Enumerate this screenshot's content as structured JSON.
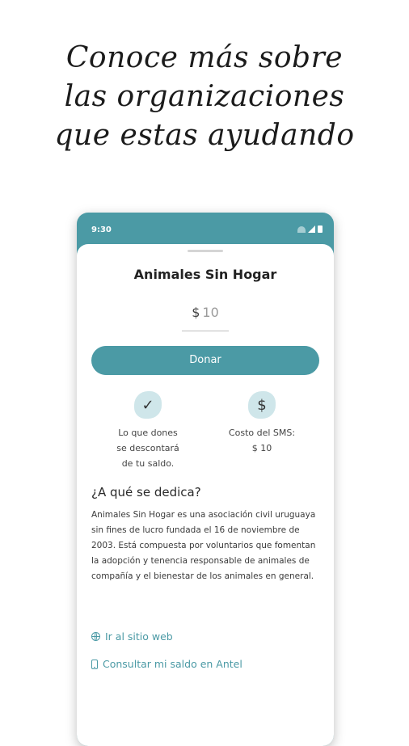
{
  "headline": [
    "Conoce más sobre",
    "las organizaciones",
    "que estas ayudando"
  ],
  "status": {
    "time": "9:30"
  },
  "organization": {
    "name": "Animales Sin Hogar"
  },
  "donation": {
    "currency": "$",
    "amount": "10",
    "button_label": "Donar"
  },
  "info": [
    {
      "icon": "check-icon",
      "glyph": "✓",
      "lines": [
        "Lo que dones",
        "se descontará",
        "de tu saldo."
      ]
    },
    {
      "icon": "dollar-icon",
      "glyph": "$",
      "lines": [
        "Costo del SMS:",
        "$ 10"
      ]
    }
  ],
  "about": {
    "title": "¿A qué se dedica?",
    "text": "Animales Sin Hogar es una asociación civil uruguaya sin fines de lucro fundada el 16 de noviembre de 2003. Está compuesta por voluntarios que fomentan la adopción y tenencia responsable de animales de compañía y el bienestar de los animales en general."
  },
  "links": {
    "website": "Ir al sitio web",
    "balance": "Consultar mi saldo en Antel"
  },
  "colors": {
    "accent": "#4b9aa5",
    "icon_bg": "#cfe6ea"
  }
}
